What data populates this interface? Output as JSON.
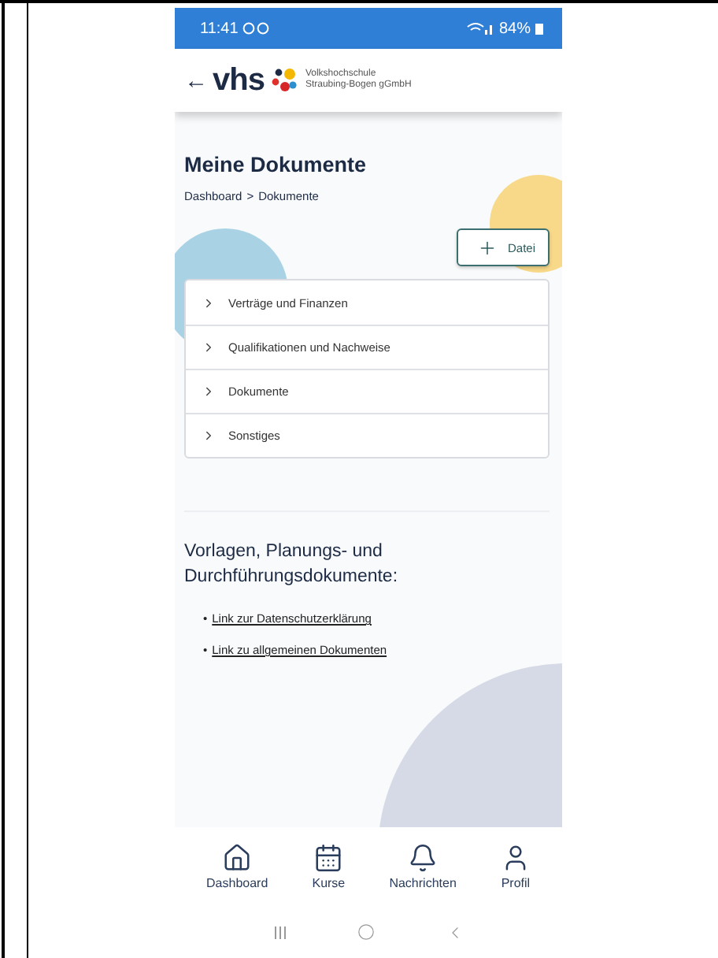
{
  "status_bar": {
    "time": "11:41",
    "battery": "84%"
  },
  "header": {
    "back": "←",
    "logo_text": "vhs",
    "org_lines": [
      "Volkshochschule",
      "Straubing-Bogen gGmbH"
    ]
  },
  "page": {
    "title": "Meine Dokumente",
    "breadcrumb": {
      "items": [
        "Dashboard",
        "Dokumente"
      ],
      "separator": ">"
    },
    "add_button": "Datei"
  },
  "folders": [
    {
      "label": "Verträge und Finanzen",
      "expanded": false
    },
    {
      "label": "Qualifikationen und Nachweise",
      "expanded": false
    },
    {
      "label": "Dokumente",
      "expanded": false
    },
    {
      "label": "Sonstiges",
      "expanded": false
    }
  ],
  "templates": {
    "heading": "Vorlagen, Planungs- und Durchführungsdokumente:",
    "bullet": "•",
    "links": [
      "Link zur Datenschutzerklärung",
      "Link zu allgemeinen Dokumenten"
    ]
  },
  "bottom_nav": [
    {
      "kind": "home",
      "label": "Dashboard"
    },
    {
      "kind": "calendar",
      "label": "Kurse"
    },
    {
      "kind": "bell",
      "label": "Nachrichten"
    },
    {
      "kind": "user",
      "label": "Profil"
    }
  ]
}
